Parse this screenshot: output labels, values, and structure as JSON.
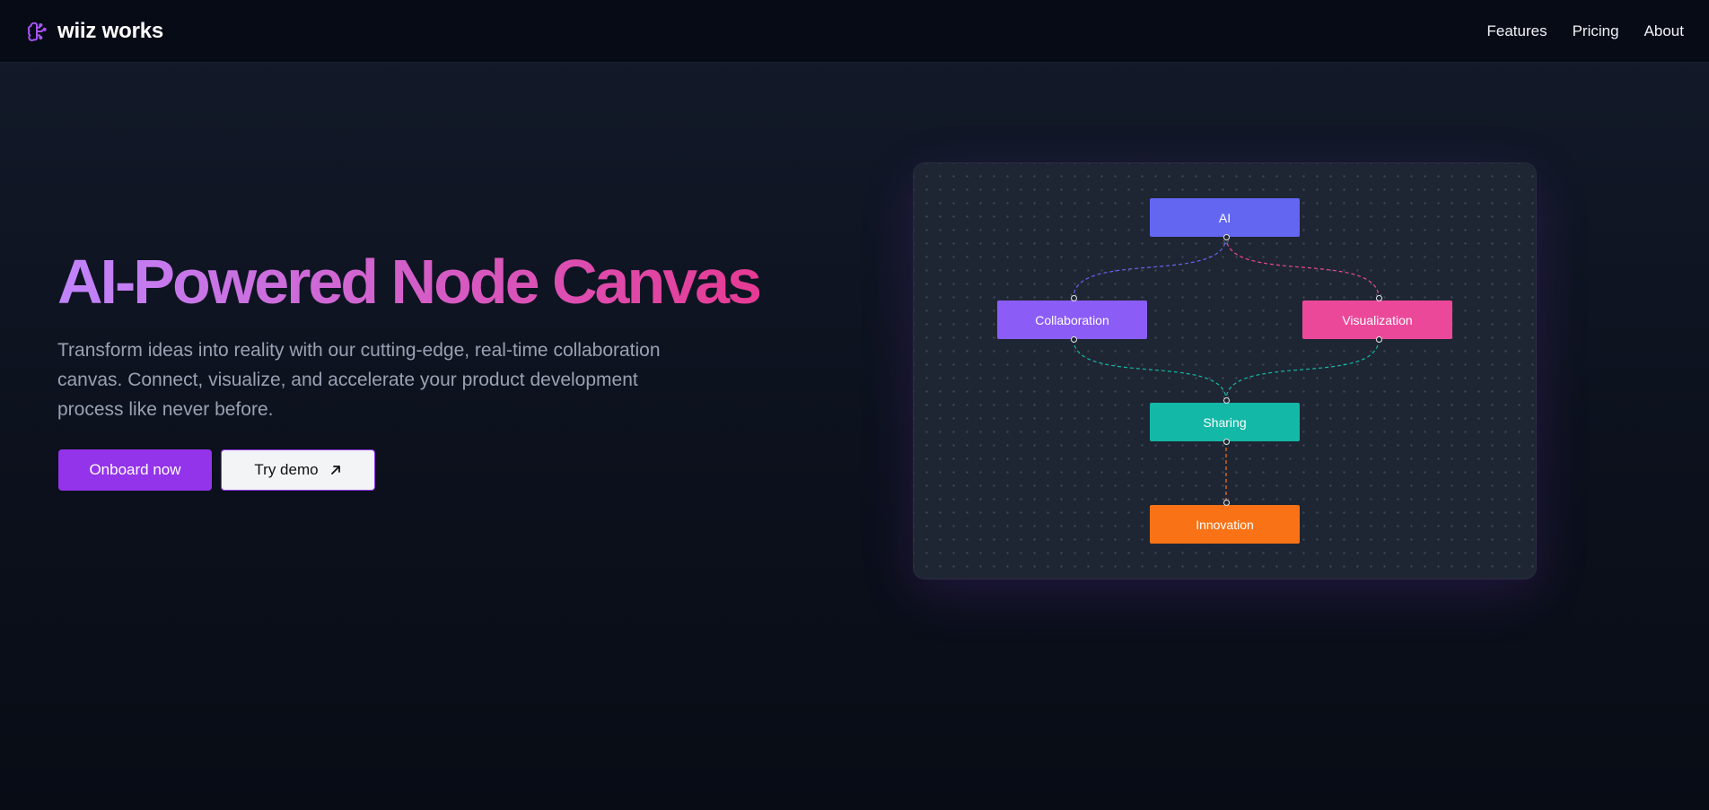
{
  "header": {
    "brand_name": "wiiz works",
    "brand_icon": "brain-icon",
    "nav": [
      "Features",
      "Pricing",
      "About"
    ]
  },
  "hero": {
    "title": "AI-Powered Node Canvas",
    "subtitle": "Transform ideas into reality with our cutting-edge, real-time collaboration canvas. Connect, visualize, and accelerate your product development process like never before.",
    "primary_button": "Onboard now",
    "secondary_button": "Try demo",
    "secondary_icon": "arrow-up-right-icon"
  },
  "canvas": {
    "nodes": [
      {
        "id": "ai",
        "label": "AI",
        "color": "#6366f1"
      },
      {
        "id": "collab",
        "label": "Collaboration",
        "color": "#8b5cf6"
      },
      {
        "id": "viz",
        "label": "Visualization",
        "color": "#ec4899"
      },
      {
        "id": "share",
        "label": "Sharing",
        "color": "#14b8a6"
      },
      {
        "id": "innov",
        "label": "Innovation",
        "color": "#f97316"
      }
    ],
    "edges": [
      {
        "from": "ai",
        "to": "collab",
        "color": "#6366f1"
      },
      {
        "from": "ai",
        "to": "viz",
        "color": "#ec4899"
      },
      {
        "from": "collab",
        "to": "share",
        "color": "#14b8a6"
      },
      {
        "from": "viz",
        "to": "share",
        "color": "#14b8a6"
      },
      {
        "from": "share",
        "to": "innov",
        "color": "#f97316"
      }
    ]
  },
  "colors": {
    "accent": "#9333ea",
    "title_gradient_start": "#c084fc",
    "title_gradient_end": "#e63a93"
  }
}
